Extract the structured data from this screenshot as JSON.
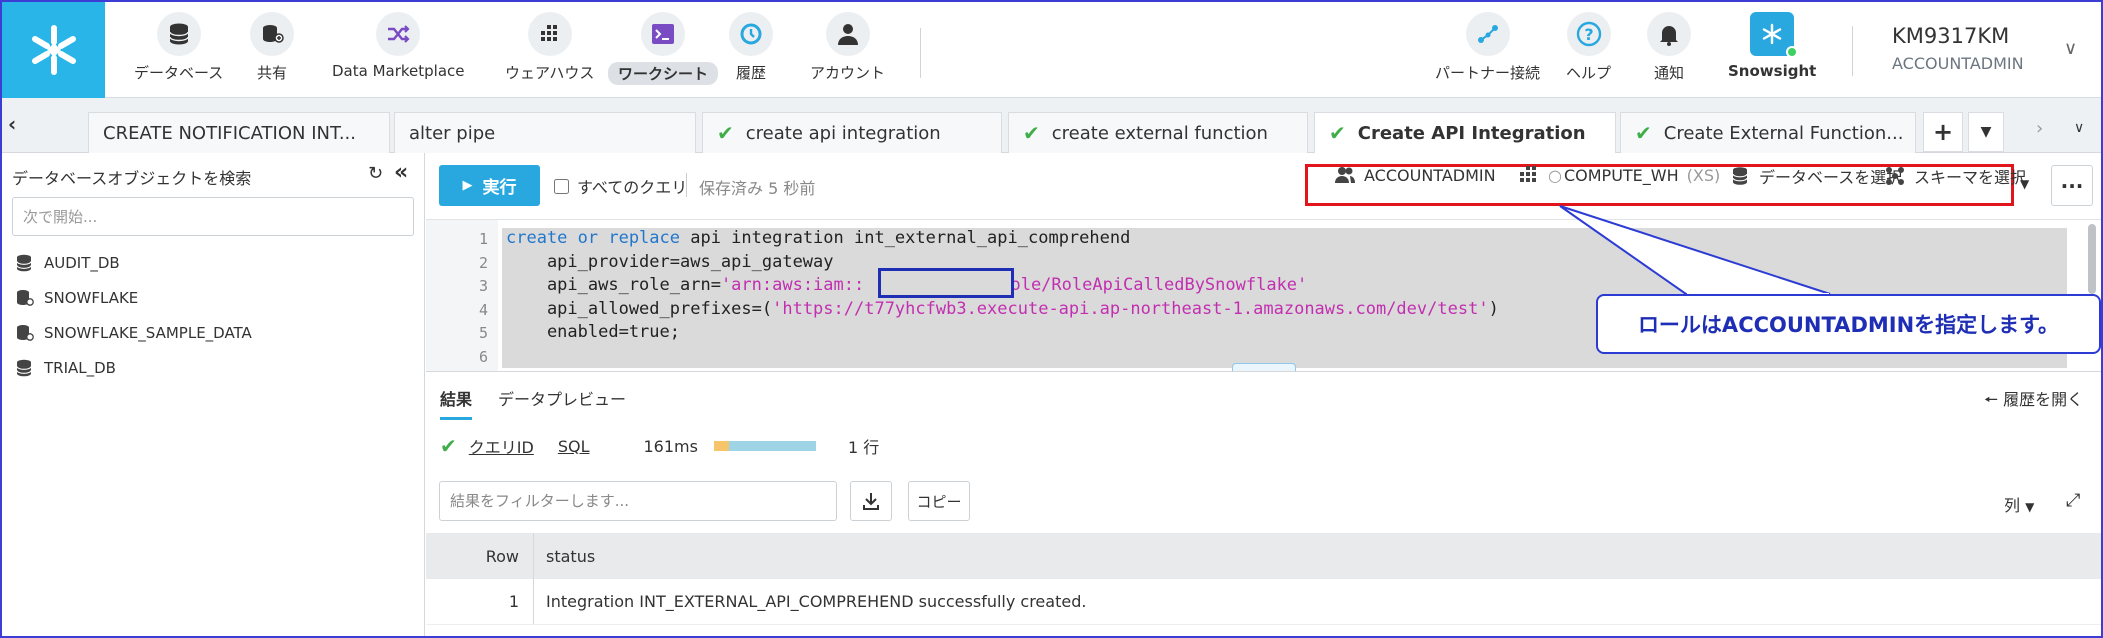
{
  "nav": {
    "items": [
      {
        "label": "データベース",
        "icon": "database-icon"
      },
      {
        "label": "共有",
        "icon": "share-icon"
      },
      {
        "label": "Data Marketplace",
        "icon": "marketplace-icon"
      },
      {
        "label": "ウェアハウス",
        "icon": "warehouse-icon"
      },
      {
        "label": "ワークシート",
        "icon": "worksheet-icon"
      },
      {
        "label": "履歴",
        "icon": "history-icon"
      },
      {
        "label": "アカウント",
        "icon": "account-icon"
      }
    ],
    "right_items": [
      {
        "label": "パートナー接続",
        "icon": "partner-connect-icon"
      },
      {
        "label": "ヘルプ",
        "icon": "help-icon"
      },
      {
        "label": "通知",
        "icon": "bell-icon"
      },
      {
        "label": "Snowsight",
        "icon": "snowsight-icon"
      }
    ],
    "user_name": "KM9317KM",
    "user_role": "ACCOUNTADMIN"
  },
  "tabs": [
    {
      "label": "CREATE NOTIFICATION INT...",
      "checked": false
    },
    {
      "label": "alter pipe",
      "checked": false
    },
    {
      "label": "create api integration",
      "checked": true
    },
    {
      "label": "create external function",
      "checked": true
    },
    {
      "label": "Create API Integration",
      "checked": true
    },
    {
      "label": "Create External Function...",
      "checked": true
    }
  ],
  "sidebar": {
    "title": "データベースオブジェクトを検索",
    "search_placeholder": "次で開始...",
    "databases": [
      "AUDIT_DB",
      "SNOWFLAKE",
      "SNOWFLAKE_SAMPLE_DATA",
      "TRIAL_DB"
    ]
  },
  "toolbar": {
    "run_label": "実行",
    "all_queries_label": "すべてのクエリ",
    "saved_text": "保存済み 5 秒前",
    "role": "ACCOUNTADMIN",
    "warehouse": "COMPUTE_WH",
    "warehouse_size": "(XS)",
    "database_select": "データベースを選択",
    "schema_select": "スキーマを選択"
  },
  "editor": {
    "line_numbers": [
      "1",
      "2",
      "3",
      "4",
      "5",
      "6"
    ],
    "line1_kw": "create or replace",
    "line1_rest": " api integration int_external_api_comprehend",
    "line2": "    api_provider=aws_api_gateway",
    "line3_a": "    api_aws_role_arn=",
    "line3_b": "'arn:aws:iam::",
    "line3_c": "role/RoleApiCalledBySnowflake'",
    "line4_a": "    api_allowed_prefixes=(",
    "line4_b": "'https://t77yhcfwb3.execute-api.ap-northeast-1.amazonaws.com/dev/test'",
    "line4_c": ")",
    "line5": "    enabled=true;"
  },
  "callout": {
    "text": "ロールはACCOUNTADMINを指定します。"
  },
  "results": {
    "tabs": [
      "結果",
      "データプレビュー"
    ],
    "history_open": "履歴を開く",
    "query_id": "クエリID",
    "sql": "SQL",
    "duration": "161ms",
    "progress_compile_fraction": 0.15,
    "rows_count": "1 行",
    "filter_placeholder": "結果をフィルターします...",
    "copy_label": "コピー",
    "columns_label": "列",
    "headers": [
      "Row",
      "status"
    ],
    "rows": [
      [
        "1",
        "Integration INT_EXTERNAL_API_COMPREHEND successfully created."
      ]
    ]
  },
  "colors": {
    "brand": "#29b5e8",
    "run_button": "#29a8e0",
    "success": "#3fae49",
    "highlight_box": "#e2141c",
    "callout": "#1f2fb5"
  }
}
